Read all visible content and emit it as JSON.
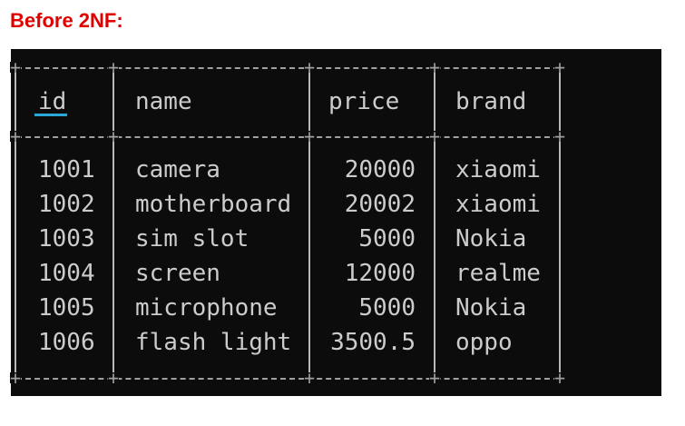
{
  "heading": {
    "text": "Before 2NF:",
    "color": "#e00000"
  },
  "table": {
    "columns": [
      "id",
      "name",
      "price",
      "brand"
    ],
    "rows": [
      {
        "id": "1001",
        "name": "camera",
        "price": "20000",
        "brand": "xiaomi"
      },
      {
        "id": "1002",
        "name": "motherboard",
        "price": "20002",
        "brand": "xiaomi"
      },
      {
        "id": "1003",
        "name": "sim slot",
        "price": "5000",
        "brand": "Nokia"
      },
      {
        "id": "1004",
        "name": "screen",
        "price": "12000",
        "brand": "realme"
      },
      {
        "id": "1005",
        "name": "microphone",
        "price": "5000",
        "brand": "Nokia"
      },
      {
        "id": "1006",
        "name": "flash light",
        "price": "3500.5",
        "brand": "oppo"
      }
    ]
  },
  "colors": {
    "terminal_bg": "#0c0c0c",
    "terminal_text": "#cccccc",
    "cursor_underline": "#2aa9d8"
  }
}
